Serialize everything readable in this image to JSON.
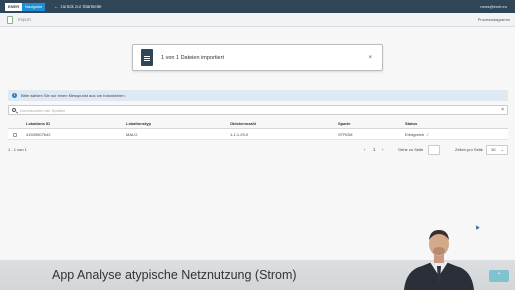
{
  "topbar": {
    "logo_left": "ENER",
    "logo_right": "Navigator",
    "back_arrow": "←",
    "back_link": "zurück zur Startseite",
    "user_email": "news@enet.eu"
  },
  "subbar": {
    "page_title": "Import",
    "process_diagram": "Prozessdiagramm"
  },
  "notification": {
    "text": "1 von 1 Dateien importiert",
    "close": "×"
  },
  "info": {
    "icon": "i",
    "text": "Bitte wählen Sie nur einen Messpunkt aus um fortzufahren."
  },
  "search": {
    "placeholder": "Durchsuchen der Spalten",
    "clear": "×"
  },
  "table": {
    "columns": [
      "Lokations ID",
      "Lokationstyp",
      "Obiskennzahl",
      "Sparte",
      "Status"
    ],
    "rows": [
      {
        "lokations_id": "41539507642",
        "lokationstyp": "MALO",
        "obiskennzahl": "1-1:1.29.0",
        "sparte": "STROM",
        "status": "Erfolgreich",
        "status_icon": "✓"
      }
    ]
  },
  "pager": {
    "range_label": "1 - 1 von 1",
    "prev": "‹",
    "page": "1",
    "next": "›",
    "goto_label": "Gehe zu Seite",
    "rows_label": "Zeilen pro Seite",
    "rows_value": "10",
    "rows_chevron": "⌄"
  },
  "caption": {
    "text": "App Analyse atypische Netznutzung (Strom)"
  },
  "scroll_top": {
    "icon": "⌃"
  },
  "colors": {
    "topbar": "#2f4558",
    "accent": "#1a8fd6",
    "success": "#3a9d3a",
    "info_bg": "#dfe9f3"
  }
}
